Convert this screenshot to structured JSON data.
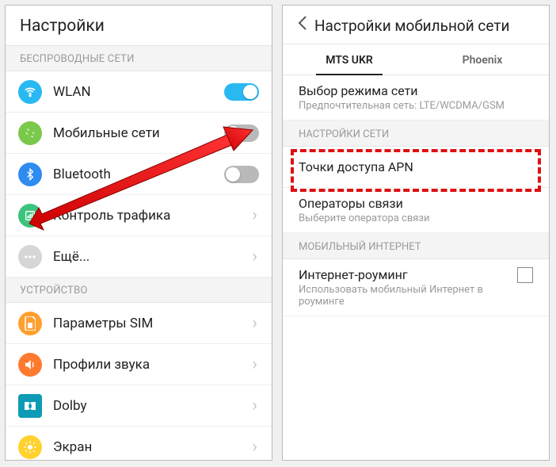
{
  "left": {
    "title": "Настройки",
    "section_wireless": "БЕСПРОВОДНЫЕ СЕТИ",
    "section_device": "УСТРОЙСТВО",
    "items": {
      "wlan": "WLAN",
      "mobile": "Мобильные сети",
      "bluetooth": "Bluetooth",
      "traffic": "Контроль трафика",
      "more": "Ещё...",
      "sim": "Параметры SIM",
      "sound": "Профили звука",
      "dolby": "Dolby",
      "display": "Экран"
    }
  },
  "right": {
    "title": "Настройки мобильной сети",
    "tabs": {
      "a": "MTS UKR",
      "b": "Phoenix"
    },
    "mode_title": "Выбор режима сети",
    "mode_sub": "Предпочтительная сеть: LTE/WCDMA/GSM",
    "sect_net": "НАСТРОЙКИ СЕТИ",
    "apn": "Точки доступа APN",
    "ops_title": "Операторы связи",
    "ops_sub": "Выберите оператора связи",
    "sect_inet": "МОБИЛЬНЫЙ ИНТЕРНЕТ",
    "roam_title": "Интернет-роуминг",
    "roam_sub": "Использовать мобильный Интернет в роуминге"
  },
  "colors": {
    "wlan": "#29b9f2",
    "mobile": "#7bc94b",
    "bluetooth": "#2f8bf0",
    "traffic": "#3cc47c",
    "more": "#d6d6d6",
    "sim": "#ff9f2e",
    "sound": "#ff7a2e",
    "dolby": "#0e9bb5",
    "display": "#ffd22e"
  }
}
